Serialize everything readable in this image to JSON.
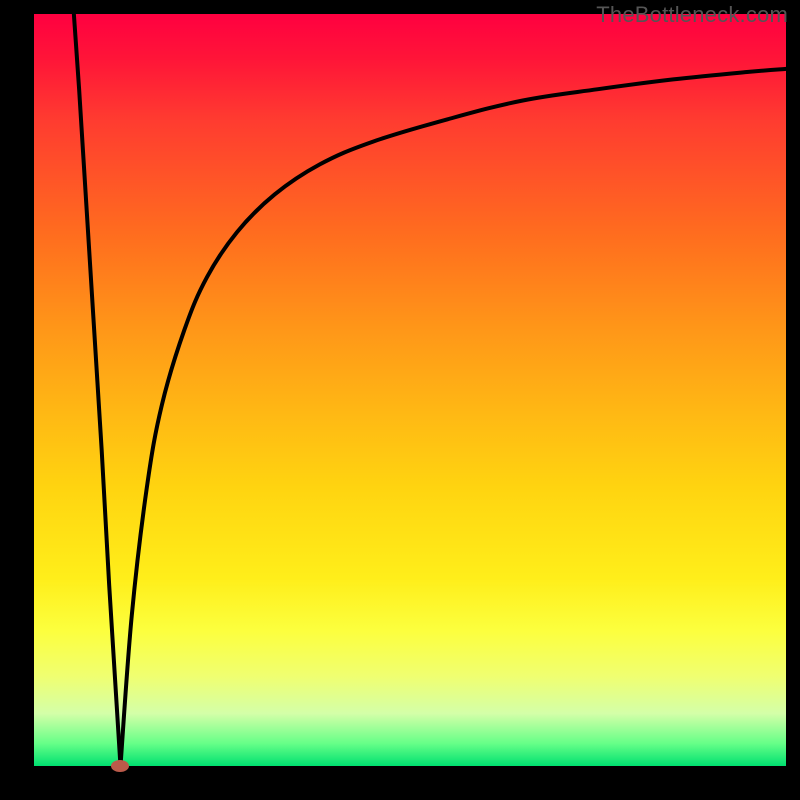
{
  "watermark": "TheBottleneck.com",
  "chart_data": {
    "type": "line",
    "title": "",
    "xlabel": "",
    "ylabel": "",
    "xlim": [
      0,
      100
    ],
    "ylim": [
      0,
      100
    ],
    "grid": false,
    "legend": false,
    "minimum_marker": {
      "x": 11.5,
      "value": 0
    },
    "series": [
      {
        "name": "left-branch",
        "x": [
          5.3,
          6,
          7,
          8,
          9,
          10,
          11.5
        ],
        "values": [
          100,
          90,
          74,
          58,
          42,
          24,
          0
        ]
      },
      {
        "name": "right-branch",
        "x": [
          11.5,
          13,
          15,
          17,
          20,
          23,
          27,
          32,
          38,
          45,
          55,
          65,
          75,
          85,
          95,
          100
        ],
        "values": [
          0,
          20,
          37,
          48,
          58,
          65,
          71,
          76,
          80,
          83,
          86,
          88.5,
          90,
          91.3,
          92.3,
          92.7
        ]
      }
    ]
  }
}
